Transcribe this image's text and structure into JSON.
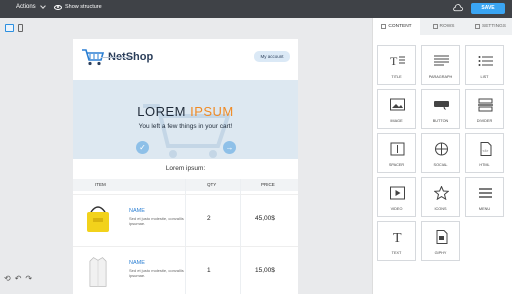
{
  "toolbar": {
    "actions_label": "Actions",
    "structure_label": "Show structure",
    "save_label": "SAVE"
  },
  "email": {
    "logo_text": "NetShop",
    "account_button": "My account",
    "hero_title_a": "LOREM ",
    "hero_title_b": "IPSUM",
    "hero_subtitle": "You left a few things in your cart!",
    "section_title": "Lorem ipsum:",
    "columns": {
      "item": "ITEM",
      "qty": "QTY",
      "price": "PRICE"
    },
    "rows": [
      {
        "name": "NAME",
        "desc": "Sed et justo molestie, convallis ipsumae.",
        "qty": "2",
        "price": "45,00$"
      },
      {
        "name": "NAME",
        "desc": "Sed et justo molestie, convallis ipsumae.",
        "qty": "1",
        "price": "15,00$"
      }
    ]
  },
  "panel": {
    "tabs": [
      "CONTENT",
      "ROWS",
      "SETTINGS"
    ],
    "blocks": [
      "TITLE",
      "PARAGRAPH",
      "LIST",
      "IMAGE",
      "BUTTON",
      "DIVIDER",
      "SPACER",
      "SOCIAL",
      "HTML",
      "VIDEO",
      "ICONS",
      "MENU",
      "TEXT",
      "GIPHY"
    ]
  },
  "colors": {
    "accent": "#3aa5f3",
    "brand_orange": "#f08a24",
    "topbar": "#3f4247"
  }
}
